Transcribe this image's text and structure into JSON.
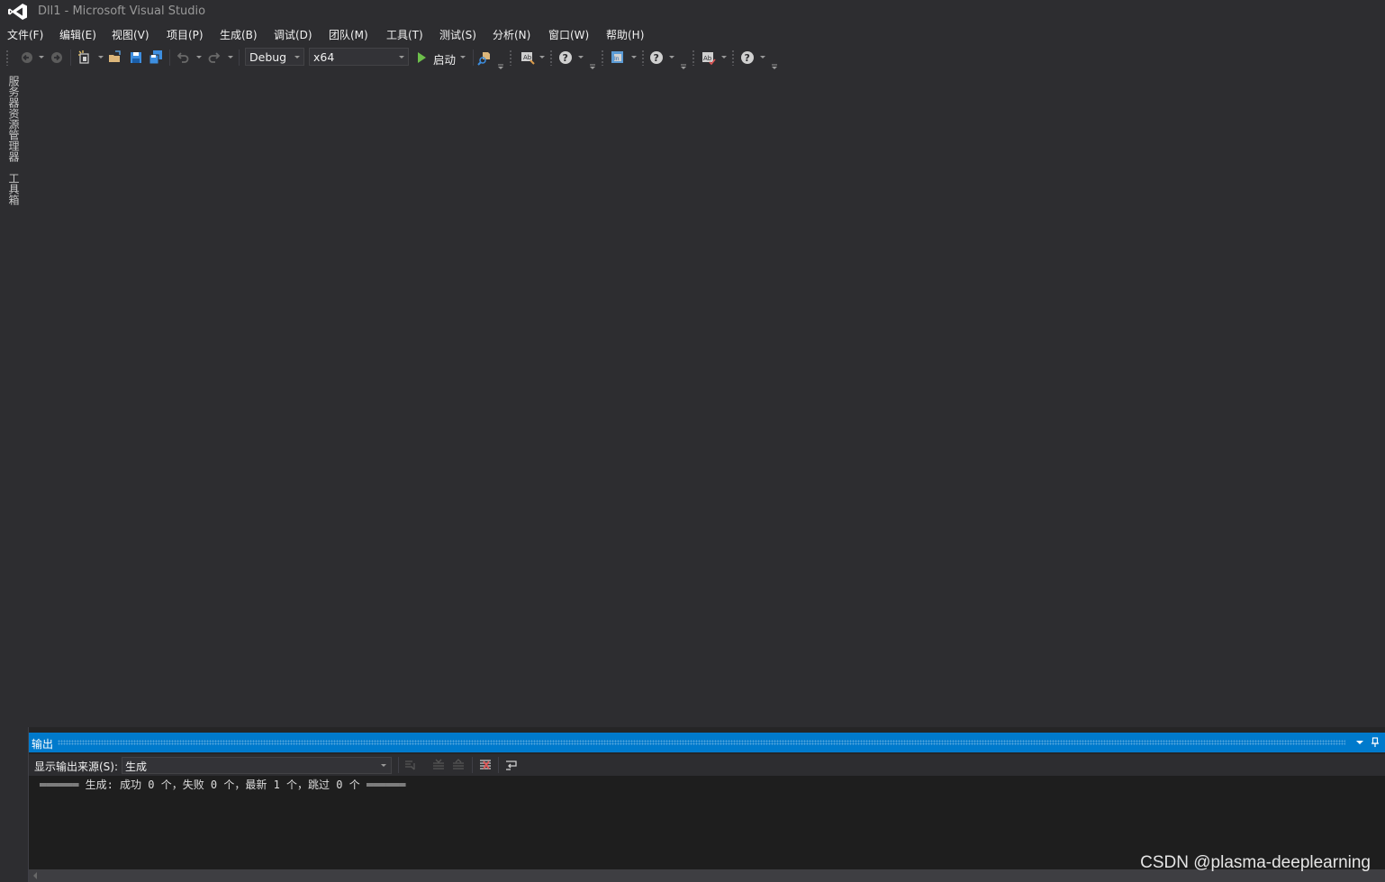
{
  "window": {
    "title": "Dll1 - Microsoft Visual Studio",
    "logo_icon": "visual-studio-logo"
  },
  "menu": [
    "文件(F)",
    "编辑(E)",
    "视图(V)",
    "项目(P)",
    "生成(B)",
    "调试(D)",
    "团队(M)",
    "工具(T)",
    "测试(S)",
    "分析(N)",
    "窗口(W)",
    "帮助(H)"
  ],
  "toolbar": {
    "configuration": "Debug",
    "platform": "x64",
    "start_label": "启动",
    "icons": [
      "back-icon",
      "forward-icon",
      "new-project-icon",
      "open-file-icon",
      "save-icon",
      "save-all-icon",
      "undo-icon",
      "redo-icon",
      "find-in-files-icon",
      "format-icon",
      "help-icon",
      "insert-icon",
      "help-icon",
      "spell-icon",
      "help-icon"
    ]
  },
  "side_tabs": {
    "server_explorer": "服务器资源管理器",
    "toolbox": "工具箱"
  },
  "output_panel": {
    "title": "输出",
    "source_label": "显示输出来源(S):",
    "source_value": "生成",
    "lines": [
      "══════ 生成: 成功 0 个，失败 0 个，最新 1 个，跳过 0 个 ══════"
    ]
  },
  "watermark": "CSDN @plasma-deeplearning",
  "colors": {
    "background": "#2d2d30",
    "accent": "#007acc",
    "output_bg": "#1e1e1e",
    "start_green": "#6dbf4b"
  }
}
